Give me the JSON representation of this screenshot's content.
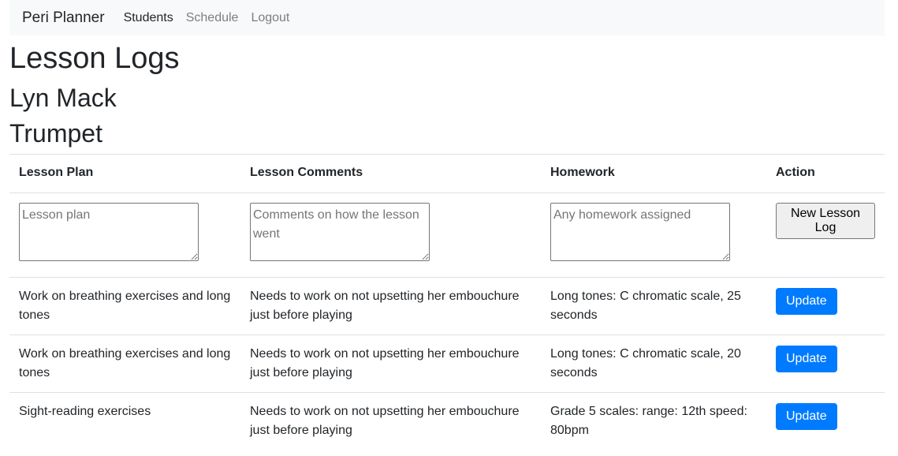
{
  "nav": {
    "brand": "Peri Planner",
    "links": [
      {
        "label": "Students",
        "active": true
      },
      {
        "label": "Schedule",
        "active": false
      },
      {
        "label": "Logout",
        "active": false
      }
    ]
  },
  "page": {
    "title": "Lesson Logs",
    "student_name": "Lyn Mack",
    "instrument": "Trumpet"
  },
  "table": {
    "headers": [
      "Lesson Plan",
      "Lesson Comments",
      "Homework",
      "Action"
    ],
    "new_row": {
      "plan_placeholder": "Lesson plan",
      "comments_placeholder": "Comments on how the lesson went",
      "homework_placeholder": "Any homework assigned",
      "button_label": "New Lesson Log"
    },
    "rows": [
      {
        "plan": "Work on breathing exercises and long tones",
        "comments": "Needs to work on not upsetting her embouchure just before playing",
        "homework": "Long tones: C chromatic scale, 25 seconds",
        "action": "Update"
      },
      {
        "plan": "Work on breathing exercises and long tones",
        "comments": "Needs to work on not upsetting her embouchure just before playing",
        "homework": "Long tones: C chromatic scale, 20 seconds",
        "action": "Update"
      },
      {
        "plan": "Sight-reading exercises",
        "comments": "Needs to work on not upsetting her embouchure just before playing",
        "homework": "Grade 5 scales: range: 12th speed: 80bpm",
        "action": "Update"
      }
    ]
  },
  "colors": {
    "primary": "#007bff",
    "navbar_bg": "#f8f9fa"
  }
}
